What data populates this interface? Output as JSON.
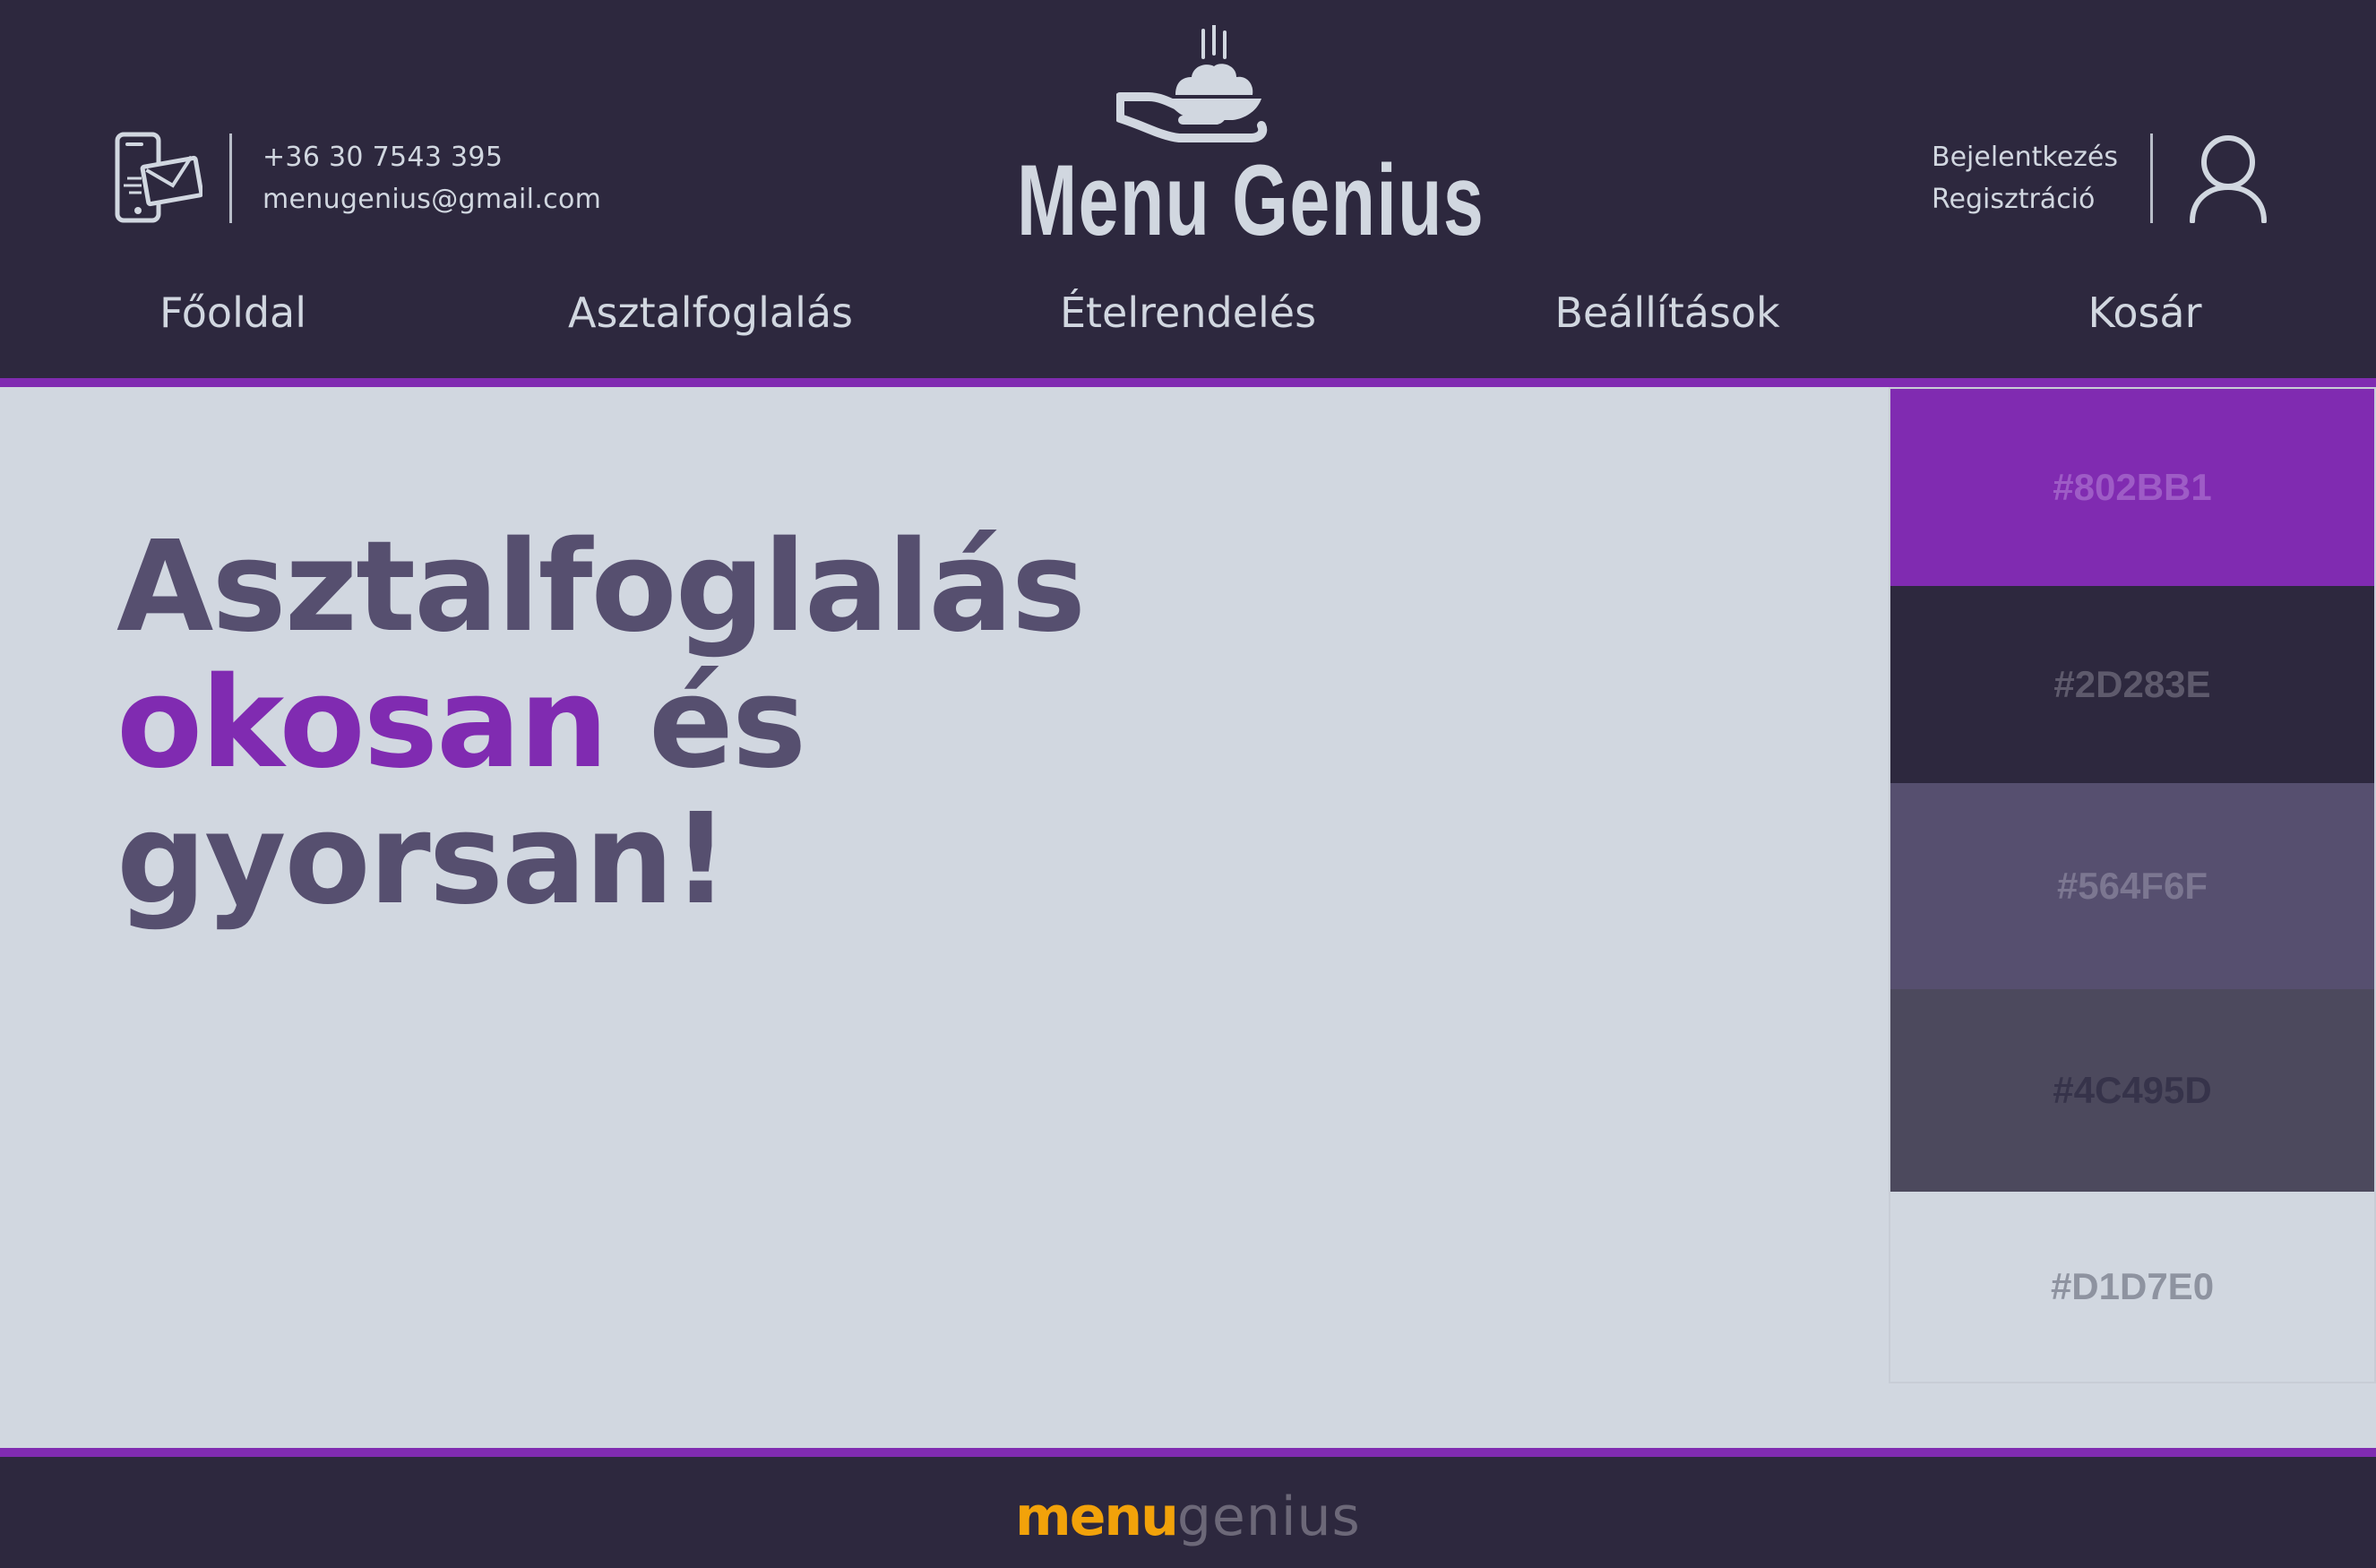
{
  "header": {
    "contact": {
      "phone": "+36 30 7543 395",
      "email": "menugenius@gmail.com",
      "icon": "phone-mail-icon"
    },
    "brand": {
      "title": "Menu Genius",
      "icon": "serving-hand-icon"
    },
    "auth": {
      "login_label": "Bejelentkezés",
      "register_label": "Regisztráció",
      "icon": "user-icon"
    },
    "nav": [
      {
        "label": "Főoldal"
      },
      {
        "label": "Asztalfoglalás"
      },
      {
        "label": "Ételrendelés"
      },
      {
        "label": "Beállítások"
      },
      {
        "label": "Kosár"
      }
    ]
  },
  "hero": {
    "line1": "Asztalfoglalás",
    "line2_accent": "okosan",
    "line2_rest": "és",
    "line3": "gyorsan!"
  },
  "palette": [
    {
      "label": "#802BB1",
      "bg": "#802BB1",
      "text_color": "#9E5CC6"
    },
    {
      "label": "#2D283E",
      "bg": "#2D283E",
      "text_color": "#5E5A6C"
    },
    {
      "label": "#564F6F",
      "bg": "#564F6F",
      "text_color": "#7C7791"
    },
    {
      "label": "#4C495D",
      "bg": "#4C495D",
      "text_color": "#36334A"
    },
    {
      "label": "#D1D7E0",
      "bg": "#D1D7E0",
      "text_color": "#8E93A0"
    }
  ],
  "footer": {
    "logo_strong": "menu",
    "logo_light": "genius"
  },
  "colors": {
    "primary": "#802BB1",
    "dark": "#2D283E",
    "muted": "#564F6F",
    "slate": "#4C495D",
    "light": "#D1D7E0",
    "footer_logo": "#F2A20A"
  }
}
